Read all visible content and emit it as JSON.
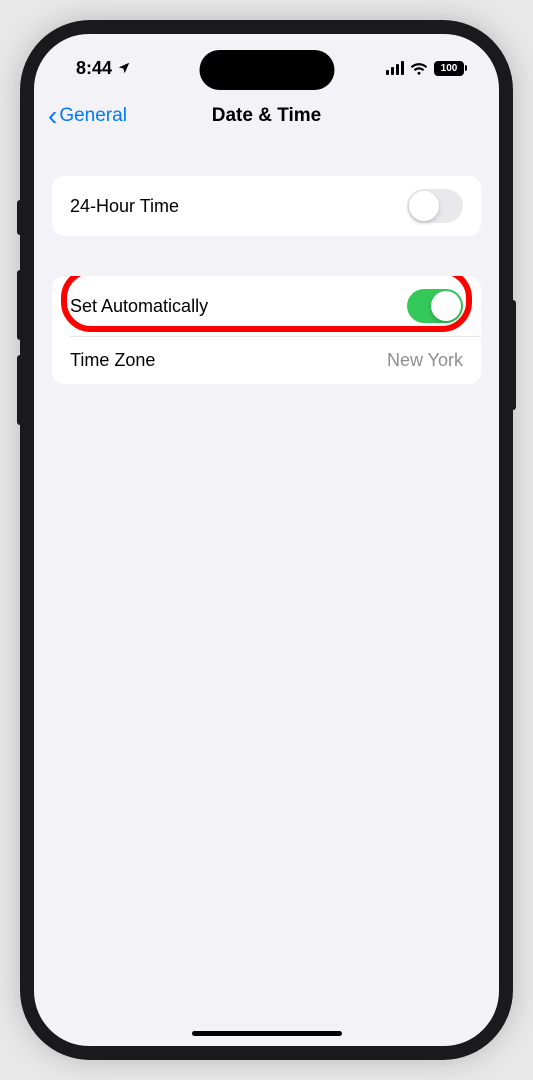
{
  "status_bar": {
    "time": "8:44",
    "battery_level": "100"
  },
  "nav": {
    "back_label": "General",
    "title": "Date & Time"
  },
  "settings": {
    "group1": {
      "row1": {
        "label": "24-Hour Time",
        "toggle_on": false
      }
    },
    "group2": {
      "row1": {
        "label": "Set Automatically",
        "toggle_on": true
      },
      "row2": {
        "label": "Time Zone",
        "value": "New York"
      }
    }
  }
}
